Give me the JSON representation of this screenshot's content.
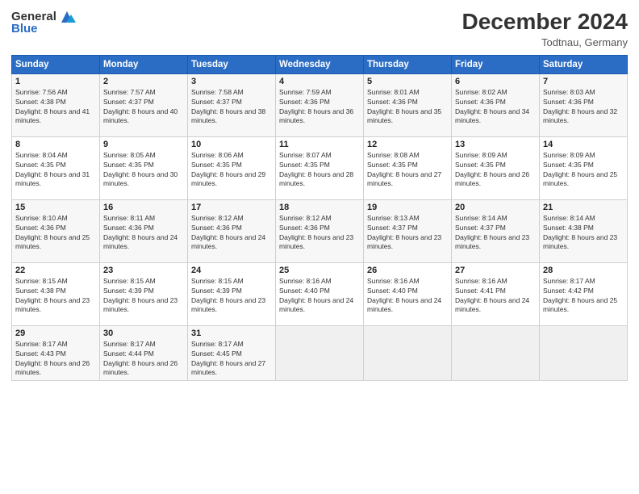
{
  "header": {
    "logo_general": "General",
    "logo_blue": "Blue",
    "month_year": "December 2024",
    "location": "Todtnau, Germany"
  },
  "weekdays": [
    "Sunday",
    "Monday",
    "Tuesday",
    "Wednesday",
    "Thursday",
    "Friday",
    "Saturday"
  ],
  "weeks": [
    [
      {
        "day": "1",
        "sunrise": "7:56 AM",
        "sunset": "4:38 PM",
        "daylight": "8 hours and 41 minutes."
      },
      {
        "day": "2",
        "sunrise": "7:57 AM",
        "sunset": "4:37 PM",
        "daylight": "8 hours and 40 minutes."
      },
      {
        "day": "3",
        "sunrise": "7:58 AM",
        "sunset": "4:37 PM",
        "daylight": "8 hours and 38 minutes."
      },
      {
        "day": "4",
        "sunrise": "7:59 AM",
        "sunset": "4:36 PM",
        "daylight": "8 hours and 36 minutes."
      },
      {
        "day": "5",
        "sunrise": "8:01 AM",
        "sunset": "4:36 PM",
        "daylight": "8 hours and 35 minutes."
      },
      {
        "day": "6",
        "sunrise": "8:02 AM",
        "sunset": "4:36 PM",
        "daylight": "8 hours and 34 minutes."
      },
      {
        "day": "7",
        "sunrise": "8:03 AM",
        "sunset": "4:36 PM",
        "daylight": "8 hours and 32 minutes."
      }
    ],
    [
      {
        "day": "8",
        "sunrise": "8:04 AM",
        "sunset": "4:35 PM",
        "daylight": "8 hours and 31 minutes."
      },
      {
        "day": "9",
        "sunrise": "8:05 AM",
        "sunset": "4:35 PM",
        "daylight": "8 hours and 30 minutes."
      },
      {
        "day": "10",
        "sunrise": "8:06 AM",
        "sunset": "4:35 PM",
        "daylight": "8 hours and 29 minutes."
      },
      {
        "day": "11",
        "sunrise": "8:07 AM",
        "sunset": "4:35 PM",
        "daylight": "8 hours and 28 minutes."
      },
      {
        "day": "12",
        "sunrise": "8:08 AM",
        "sunset": "4:35 PM",
        "daylight": "8 hours and 27 minutes."
      },
      {
        "day": "13",
        "sunrise": "8:09 AM",
        "sunset": "4:35 PM",
        "daylight": "8 hours and 26 minutes."
      },
      {
        "day": "14",
        "sunrise": "8:09 AM",
        "sunset": "4:35 PM",
        "daylight": "8 hours and 25 minutes."
      }
    ],
    [
      {
        "day": "15",
        "sunrise": "8:10 AM",
        "sunset": "4:36 PM",
        "daylight": "8 hours and 25 minutes."
      },
      {
        "day": "16",
        "sunrise": "8:11 AM",
        "sunset": "4:36 PM",
        "daylight": "8 hours and 24 minutes."
      },
      {
        "day": "17",
        "sunrise": "8:12 AM",
        "sunset": "4:36 PM",
        "daylight": "8 hours and 24 minutes."
      },
      {
        "day": "18",
        "sunrise": "8:12 AM",
        "sunset": "4:36 PM",
        "daylight": "8 hours and 23 minutes."
      },
      {
        "day": "19",
        "sunrise": "8:13 AM",
        "sunset": "4:37 PM",
        "daylight": "8 hours and 23 minutes."
      },
      {
        "day": "20",
        "sunrise": "8:14 AM",
        "sunset": "4:37 PM",
        "daylight": "8 hours and 23 minutes."
      },
      {
        "day": "21",
        "sunrise": "8:14 AM",
        "sunset": "4:38 PM",
        "daylight": "8 hours and 23 minutes."
      }
    ],
    [
      {
        "day": "22",
        "sunrise": "8:15 AM",
        "sunset": "4:38 PM",
        "daylight": "8 hours and 23 minutes."
      },
      {
        "day": "23",
        "sunrise": "8:15 AM",
        "sunset": "4:39 PM",
        "daylight": "8 hours and 23 minutes."
      },
      {
        "day": "24",
        "sunrise": "8:15 AM",
        "sunset": "4:39 PM",
        "daylight": "8 hours and 23 minutes."
      },
      {
        "day": "25",
        "sunrise": "8:16 AM",
        "sunset": "4:40 PM",
        "daylight": "8 hours and 24 minutes."
      },
      {
        "day": "26",
        "sunrise": "8:16 AM",
        "sunset": "4:40 PM",
        "daylight": "8 hours and 24 minutes."
      },
      {
        "day": "27",
        "sunrise": "8:16 AM",
        "sunset": "4:41 PM",
        "daylight": "8 hours and 24 minutes."
      },
      {
        "day": "28",
        "sunrise": "8:17 AM",
        "sunset": "4:42 PM",
        "daylight": "8 hours and 25 minutes."
      }
    ],
    [
      {
        "day": "29",
        "sunrise": "8:17 AM",
        "sunset": "4:43 PM",
        "daylight": "8 hours and 26 minutes."
      },
      {
        "day": "30",
        "sunrise": "8:17 AM",
        "sunset": "4:44 PM",
        "daylight": "8 hours and 26 minutes."
      },
      {
        "day": "31",
        "sunrise": "8:17 AM",
        "sunset": "4:45 PM",
        "daylight": "8 hours and 27 minutes."
      },
      null,
      null,
      null,
      null
    ]
  ]
}
